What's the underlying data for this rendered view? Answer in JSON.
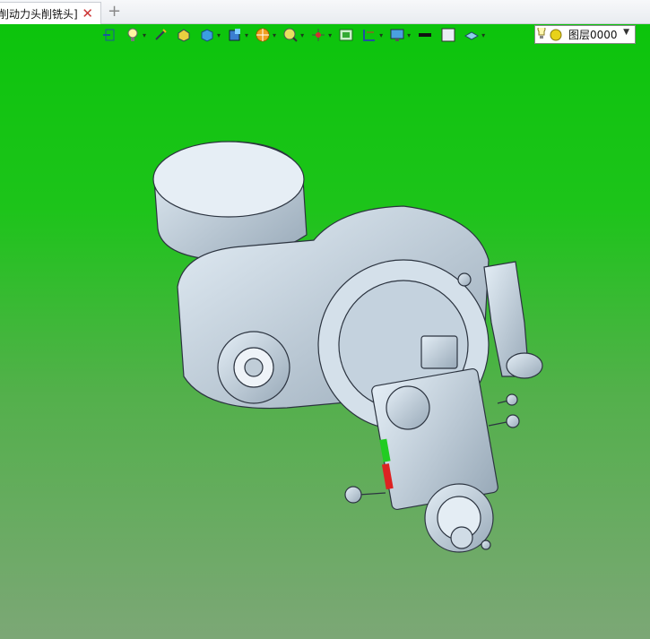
{
  "tab": {
    "title": "削动力头削铣头]",
    "close_symbol": "✕",
    "new_tab_symbol": "+"
  },
  "toolbar": {
    "buttons": [
      {
        "name": "exit-icon",
        "caret": false
      },
      {
        "name": "light-bulb-icon",
        "caret": true
      },
      {
        "name": "pen-icon",
        "caret": false
      },
      {
        "name": "box-face-icon",
        "caret": false
      },
      {
        "name": "cube-icon",
        "caret": true
      },
      {
        "name": "view-cube-icon",
        "caret": true
      },
      {
        "name": "section-icon",
        "caret": true
      },
      {
        "name": "zoom-fit-icon",
        "caret": true
      },
      {
        "name": "axis-icon",
        "caret": true
      },
      {
        "name": "frame-icon",
        "caret": false
      },
      {
        "name": "dimension-icon",
        "caret": true
      },
      {
        "name": "display-icon",
        "caret": true
      },
      {
        "name": "line-color-icon",
        "caret": false
      },
      {
        "name": "fill-color-icon",
        "caret": false
      },
      {
        "name": "layer-stack-icon",
        "caret": true
      }
    ],
    "caret_symbol": "▾"
  },
  "layer": {
    "label": "图层0000",
    "caret": "▼"
  },
  "colors": {
    "viewport_top": "#0cc40c",
    "viewport_bottom": "#7ca776",
    "model": "#c8d8e6",
    "model_edge": "#2c3440"
  }
}
